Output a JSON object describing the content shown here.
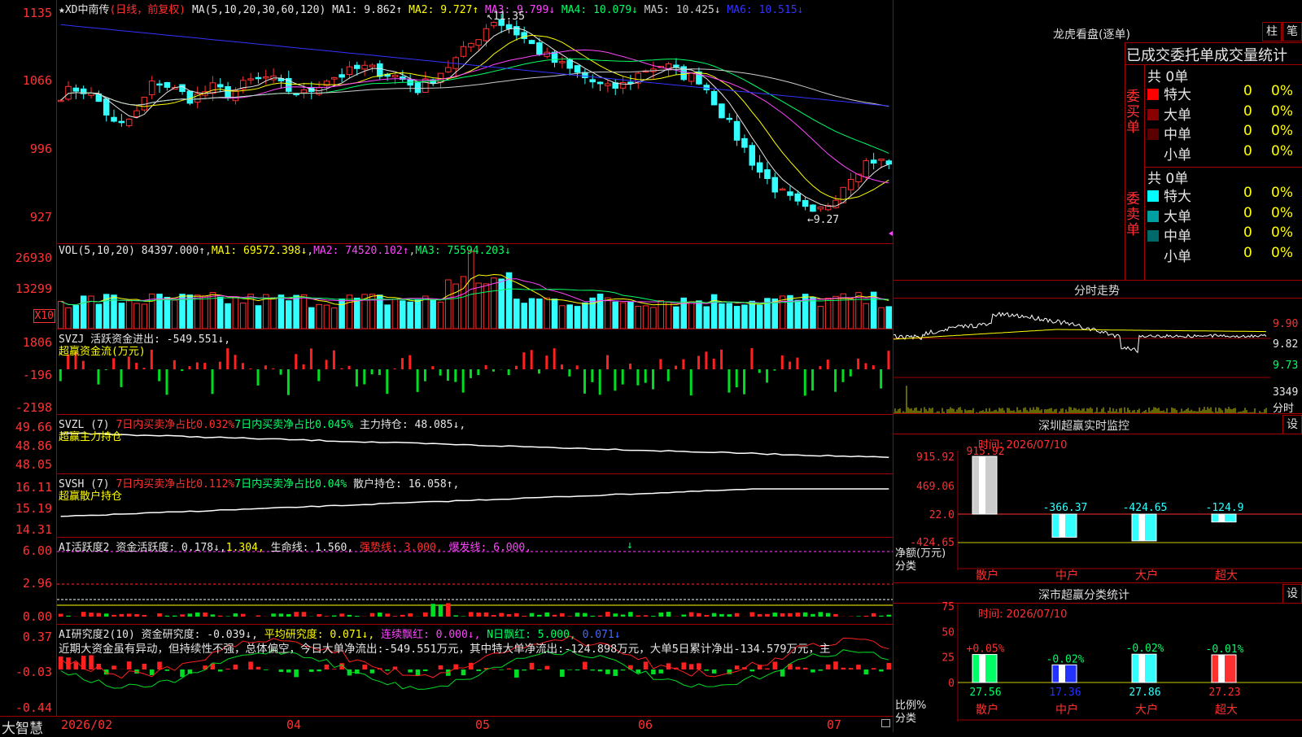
{
  "main": {
    "title": "★XD中南传",
    "mode": "(日线，前复权)",
    "ma_params": "MA(5,10,20,30,60,120)",
    "ma": [
      {
        "label": "MA1:",
        "value": "9.862↑",
        "color": "#e6e6e6"
      },
      {
        "label": "MA2:",
        "value": "9.727↑",
        "color": "#ffff00"
      },
      {
        "label": "MA3:",
        "value": "9.799↓",
        "color": "#ff44ff"
      },
      {
        "label": "MA4:",
        "value": "10.079↓",
        "color": "#00ff66"
      },
      {
        "label": "MA5:",
        "value": "10.425↓",
        "color": "#cccccc"
      },
      {
        "label": "MA6:",
        "value": "10.515↓",
        "color": "#3333ff"
      }
    ],
    "y_ticks": [
      "1135",
      "1066",
      "996",
      "927"
    ],
    "high_mark": "11.35",
    "low_mark": "9.27"
  },
  "vol": {
    "header": "VOL(5,10,20)",
    "value": "84397.000↑",
    "ma1": "69572.398↓",
    "ma2": "74520.102↑",
    "ma3": "75594.203↓",
    "y_ticks": [
      "26930",
      "13299"
    ],
    "unit": "X10"
  },
  "svzj": {
    "header": "SVZJ  活跃资金进出:",
    "value": "-549.551↓,",
    "sub": "超赢资金流(万元)",
    "y_ticks": [
      "1806",
      "-196",
      "-2198"
    ]
  },
  "svzl": {
    "header": "SVZL (7)",
    "t1": "7日内买卖净占比0.032%",
    "t2": "7日内买卖净占比0.045%",
    "t3": "主力持仓: 48.085↓,",
    "sub": "超赢主力持仓",
    "y_ticks": [
      "49.66",
      "48.86",
      "48.05"
    ]
  },
  "svsh": {
    "header": "SVSH (7)",
    "t1": "7日内买卖净占比0.112%",
    "t2": "7日内买卖净占比0.04%",
    "t3": "散户持仓: 16.058↑,",
    "sub": "超赢散户持仓",
    "y_ticks": [
      "16.11",
      "15.19",
      "14.31"
    ]
  },
  "ai_active": {
    "header": "AI活跃度2",
    "t1": "资金活跃度: 0.178↓,",
    "t2": "1.304,",
    "t3": "生命线: 1.560,",
    "t4": "强势线: 3.000,",
    "t5": "爆发线: 6.000,",
    "y_ticks": [
      "6.00",
      "2.96",
      "0.00"
    ]
  },
  "ai_research": {
    "header": "AI研究度2(10)",
    "t1": "资金研究度: -0.039↓,",
    "t2": "平均研究度: 0.071↓,",
    "t3": "连续飘红: 0.000↓,",
    "t4": "N日飘红: 5.000,",
    "t5": "0.071↓",
    "comment": "近期大资金虽有异动，但持续性不强，总体偏空，今日大单净流出:-549.551万元，其中特大单净流出:-124.898万元，大单5日累计净出-134.579万元，主",
    "y_ticks": [
      "0.37",
      "-0.03",
      "-0.44"
    ]
  },
  "bottom": {
    "brand": "大智慧",
    "dates": [
      "2026/02",
      "04",
      "05",
      "06",
      "07"
    ]
  },
  "dragon": {
    "title": "龙虎看盘(逐单)",
    "btn1": "柱",
    "btn2": "笔",
    "headline": "已成交委托单成交量统计",
    "buy_group": "委买单",
    "sell_group": "委卖单",
    "buy_total": "共 0单",
    "sell_total": "共 0单",
    "buy_rows": [
      {
        "name": "特大",
        "count": "0",
        "pct": "0%",
        "color": "#ff0000"
      },
      {
        "name": "大单",
        "count": "0",
        "pct": "0%",
        "color": "#8b0000"
      },
      {
        "name": "中单",
        "count": "0",
        "pct": "0%",
        "color": "#5a0000"
      },
      {
        "name": "小单",
        "count": "0",
        "pct": "0%",
        "color": "#000000"
      }
    ],
    "sell_rows": [
      {
        "name": "特大",
        "count": "0",
        "pct": "0%",
        "color": "#00ffff"
      },
      {
        "name": "大单",
        "count": "0",
        "pct": "0%",
        "color": "#00a0a0"
      },
      {
        "name": "中单",
        "count": "0",
        "pct": "0%",
        "color": "#006a6a"
      },
      {
        "name": "小单",
        "count": "0",
        "pct": "0%",
        "color": "#000000"
      }
    ]
  },
  "intraday": {
    "title": "分时走势",
    "y_ticks": [
      "9.90",
      "9.82",
      "9.73"
    ],
    "vol_tick": "3349",
    "vol_label": "分时"
  },
  "monitor": {
    "title": "深圳超赢实时监控",
    "set_btn": "设",
    "time": "时间: 2026/07/10",
    "y_ticks": [
      "915.92",
      "469.06",
      "22.0",
      "-424.65"
    ],
    "net_label": "净额(万元)",
    "cat_label": "分类",
    "bars": [
      {
        "cat": "散户",
        "value": 915.92,
        "label": "915.92",
        "color": "#cccccc"
      },
      {
        "cat": "中户",
        "value": -366.37,
        "label": "-366.37",
        "color": "#33ffff"
      },
      {
        "cat": "大户",
        "value": -424.65,
        "label": "-424.65",
        "color": "#33ffff"
      },
      {
        "cat": "超大",
        "value": -124.9,
        "label": "-124.9",
        "color": "#33ffff"
      }
    ]
  },
  "classify": {
    "title": "深市超赢分类统计",
    "set_btn": "设",
    "time": "时间: 2026/07/10",
    "y_ticks": [
      "75",
      "50",
      "25",
      "0"
    ],
    "ratio_label": "比例%",
    "cat_label": "分类",
    "bars": [
      {
        "cat": "散户",
        "value": 27.56,
        "label": "27.56",
        "delta": "+0.05%",
        "color": "#00ff66",
        "delta_color": "#ff3030"
      },
      {
        "cat": "中户",
        "value": 17.36,
        "label": "17.36",
        "delta": "-0.02%",
        "color": "#2233ff",
        "delta_color": "#00ff66"
      },
      {
        "cat": "大户",
        "value": 27.86,
        "label": "27.86",
        "delta": "-0.02%",
        "color": "#33ffff",
        "delta_color": "#00ff66"
      },
      {
        "cat": "超大",
        "value": 27.23,
        "label": "27.23",
        "delta": "-0.01%",
        "color": "#ff3030",
        "delta_color": "#00ff66"
      }
    ]
  },
  "chart_data": {
    "type": "candlestick",
    "symbol": "XD中南传",
    "ylim": [
      9.2,
      11.4
    ],
    "ma_values": {
      "MA1": 9.862,
      "MA2": 9.727,
      "MA3": 9.799,
      "MA4": 10.079,
      "MA5": 10.425,
      "MA6": 10.515
    },
    "extremes": {
      "high": 11.35,
      "low": 9.27
    },
    "x_ticks": [
      "2026/02",
      "04",
      "05",
      "06",
      "07"
    ],
    "close_path": [
      10.55,
      10.62,
      10.48,
      10.2,
      10.35,
      10.7,
      10.6,
      10.5,
      10.62,
      10.55,
      10.68,
      10.72,
      10.6,
      10.55,
      10.7,
      10.75,
      10.82,
      10.78,
      10.72,
      10.6,
      10.75,
      10.9,
      11.1,
      11.3,
      11.2,
      11.05,
      10.9,
      10.8,
      10.7,
      10.6,
      10.65,
      10.8,
      10.85,
      10.75,
      10.7,
      10.4,
      10.1,
      9.8,
      9.6,
      9.45,
      9.32,
      9.5,
      9.75,
      9.9,
      9.85
    ]
  }
}
